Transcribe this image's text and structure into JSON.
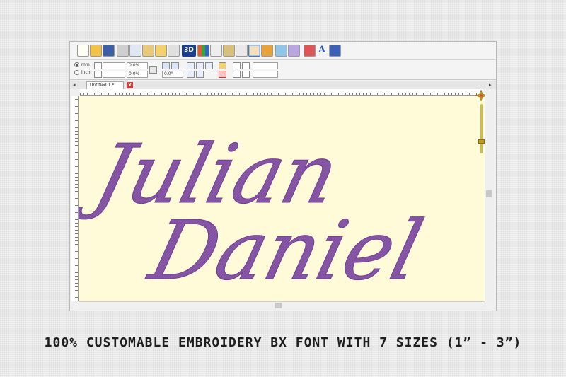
{
  "window": {
    "tab_title": "Untitled 1 *",
    "tab_close_glyph": "x",
    "nav_left": "◂",
    "nav_right": "▸"
  },
  "toolbar": {
    "three_d_label": "3D",
    "text_tool_label": "A",
    "icons": [
      "new-file-icon",
      "open-folder-icon",
      "save-icon",
      "print-icon",
      "copy-icon",
      "paste-icon",
      "mirror-h-icon",
      "mirror-v-icon",
      "3d-icon",
      "color-palette-icon",
      "zoom-icon",
      "measure-icon",
      "node-edit-icon",
      "select-hand-icon",
      "image-icon",
      "grid-icon",
      "transform-icon",
      "stitch-sim-icon",
      "text-icon",
      "design-icon"
    ]
  },
  "properties": {
    "unit_mm": "mm",
    "unit_inch": "inch",
    "width_percent": "0.0%",
    "height_percent": "0.0%",
    "rotation": "0.0°"
  },
  "canvas": {
    "line1": "Julian",
    "line2": "Daniel",
    "thread_color": "#8a59a8",
    "background_color": "#fffad8"
  },
  "caption": {
    "text": "100% CUSTOMABLE EMBROIDERY BX FONT WITH 7 SIZES (1” -  3”)"
  }
}
